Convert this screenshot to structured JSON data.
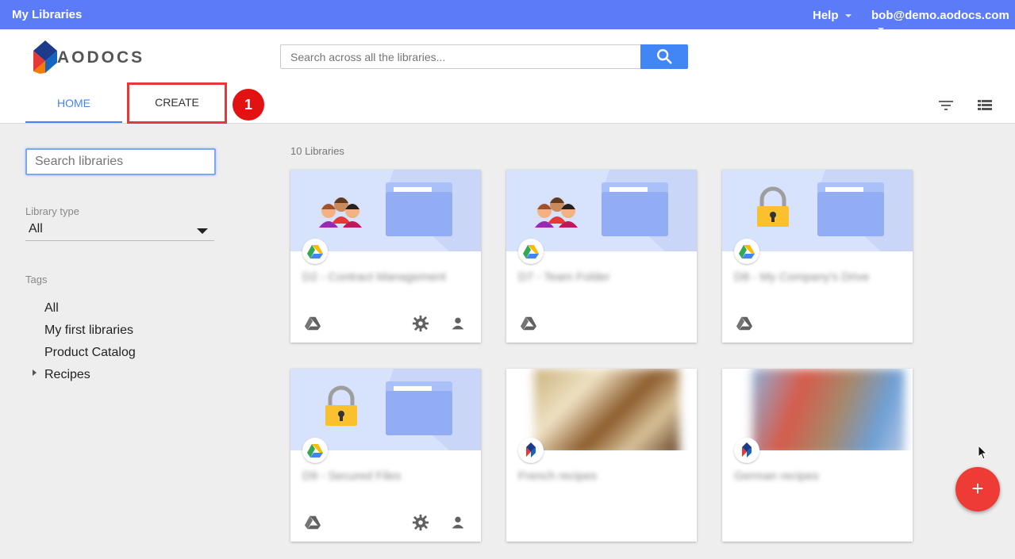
{
  "topbar": {
    "title": "My Libraries",
    "help": "Help",
    "user": "bob@demo.aodocs.com"
  },
  "header": {
    "logo_text": "AODOCS",
    "search_placeholder": "Search across all the libraries...",
    "tabs": {
      "home": "HOME",
      "create": "CREATE"
    },
    "step_badge": "1"
  },
  "sidebar": {
    "filter_placeholder": "Search libraries",
    "library_type_label": "Library type",
    "library_type_value": "All",
    "tags_label": "Tags",
    "tags": [
      "All",
      "My first libraries",
      "Product Catalog",
      "Recipes"
    ]
  },
  "content": {
    "count": "10 Libraries",
    "cards": [
      {
        "name": "D2 - Contract Management",
        "banner": "people-folder"
      },
      {
        "name": "D7 - Team Folder",
        "banner": "people-folder"
      },
      {
        "name": "D8 - My Company's Drive",
        "banner": "lock-folder"
      },
      {
        "name": "D9 - Secured Files",
        "banner": "lock-folder"
      },
      {
        "name": "French recipes",
        "banner": "photo"
      },
      {
        "name": "German recipes",
        "banner": "photo"
      }
    ]
  },
  "colors": {
    "accent": "#4285f4",
    "topbar": "#5b7cf6",
    "fab": "#ef3b36",
    "highlight": "#e53935"
  },
  "fab_label": "+"
}
